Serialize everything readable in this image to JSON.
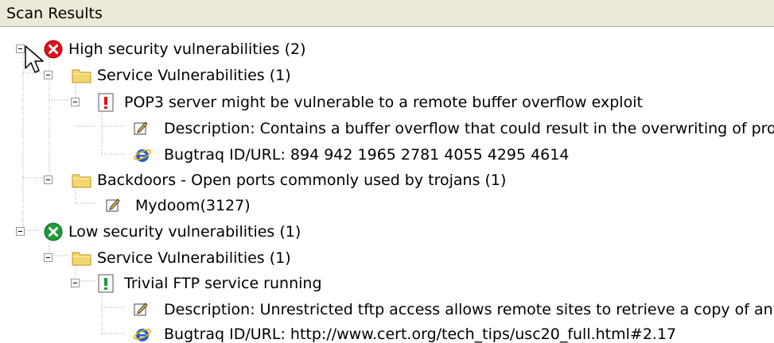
{
  "header": {
    "title": "Scan Results"
  },
  "tree": {
    "high": {
      "label": "High security vulnerabilities (2)",
      "service": {
        "label": "Service Vulnerabilities (1)",
        "item": {
          "label": "POP3 server might be vulnerable to a remote buffer overflow exploit",
          "description": "Description: Contains a buffer overflow that could result in the overwriting of proce",
          "bugtraq": "Bugtraq ID/URL: 894 942 1965 2781 4055 4295 4614"
        }
      },
      "backdoors": {
        "label": "Backdoors - Open ports commonly used by trojans (1)",
        "item": "Mydoom(3127)"
      }
    },
    "low": {
      "label": "Low security vulnerabilities (1)",
      "service": {
        "label": "Service Vulnerabilities (1)",
        "item": {
          "label": "Trivial FTP service running",
          "description": "Description: Unrestricted tftp access allows remote sites to retrieve a copy of any",
          "bugtraq": "Bugtraq ID/URL: http://www.cert.org/tech_tips/usc20_full.html#2.17"
        }
      }
    }
  },
  "colors": {
    "high_severity": "#e0101a",
    "low_severity": "#1e9a3a",
    "folder": "#f3d76b",
    "header_bg": "#ece9d8"
  },
  "icons": {
    "high_severity": "red-x-circle-icon",
    "low_severity": "green-check-circle-icon",
    "folder": "folder-icon",
    "alert": "alert-icon",
    "note": "note-icon",
    "link": "ie-link-icon"
  }
}
